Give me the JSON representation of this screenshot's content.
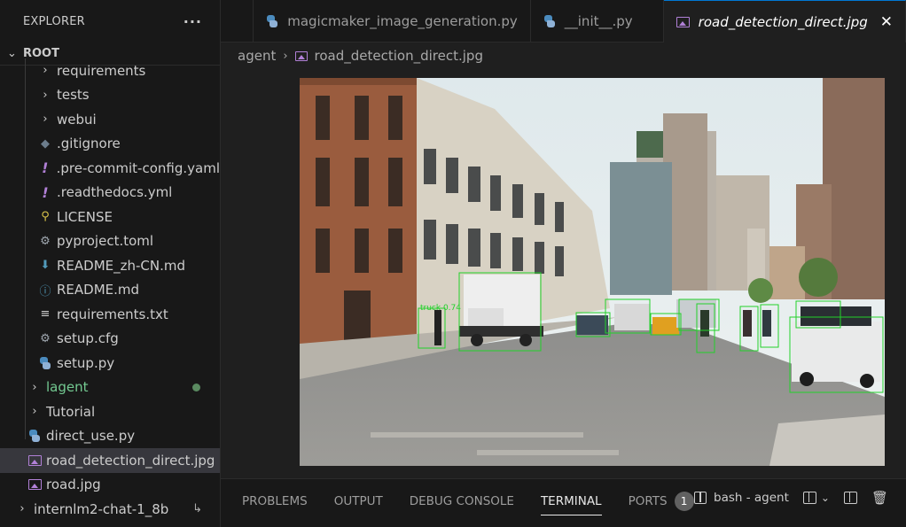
{
  "explorer": {
    "title": "EXPLORER",
    "more": "···",
    "root_label": "ROOT",
    "items": [
      {
        "label": "requirements",
        "type": "folder"
      },
      {
        "label": "tests",
        "type": "folder"
      },
      {
        "label": "webui",
        "type": "folder"
      },
      {
        "label": ".gitignore",
        "type": "file",
        "icon": "diamond-icon"
      },
      {
        "label": ".pre-commit-config.yaml",
        "type": "file",
        "icon": "exclamation-icon"
      },
      {
        "label": ".readthedocs.yml",
        "type": "file",
        "icon": "exclamation-icon"
      },
      {
        "label": "LICENSE",
        "type": "file",
        "icon": "license-icon"
      },
      {
        "label": "pyproject.toml",
        "type": "file",
        "icon": "gear-icon"
      },
      {
        "label": "README_zh-CN.md",
        "type": "file",
        "icon": "arrow-down-icon"
      },
      {
        "label": "README.md",
        "type": "file",
        "icon": "info-icon"
      },
      {
        "label": "requirements.txt",
        "type": "file",
        "icon": "lines-icon"
      },
      {
        "label": "setup.cfg",
        "type": "file",
        "icon": "gear-icon"
      },
      {
        "label": "setup.py",
        "type": "file",
        "icon": "python-icon"
      }
    ],
    "top_items": [
      {
        "label": "lagent",
        "type": "folder"
      },
      {
        "label": "Tutorial",
        "type": "folder"
      },
      {
        "label": "direct_use.py",
        "type": "file"
      },
      {
        "label": "road_detection_direct.jpg",
        "type": "file"
      },
      {
        "label": "road.jpg",
        "type": "file"
      },
      {
        "label": "internlm2-chat-1_8b",
        "type": "folder"
      }
    ]
  },
  "tabs": [
    {
      "label": "magicmaker_image_generation.py"
    },
    {
      "label": "__init__.py"
    },
    {
      "label": "road_detection_direct.jpg"
    }
  ],
  "tab_close": "✕",
  "breadcrumb": {
    "folder": "agent",
    "file": "road_detection_direct.jpg"
  },
  "panel": {
    "tabs": [
      "PROBLEMS",
      "OUTPUT",
      "DEBUG CONSOLE",
      "TERMINAL",
      "PORTS"
    ],
    "active": "TERMINAL",
    "ports_badge": "1",
    "terminal_name": "bash - agent"
  },
  "image": {
    "detections": [
      {
        "label": "truck 0.74",
        "conf": 0.74
      }
    ]
  }
}
